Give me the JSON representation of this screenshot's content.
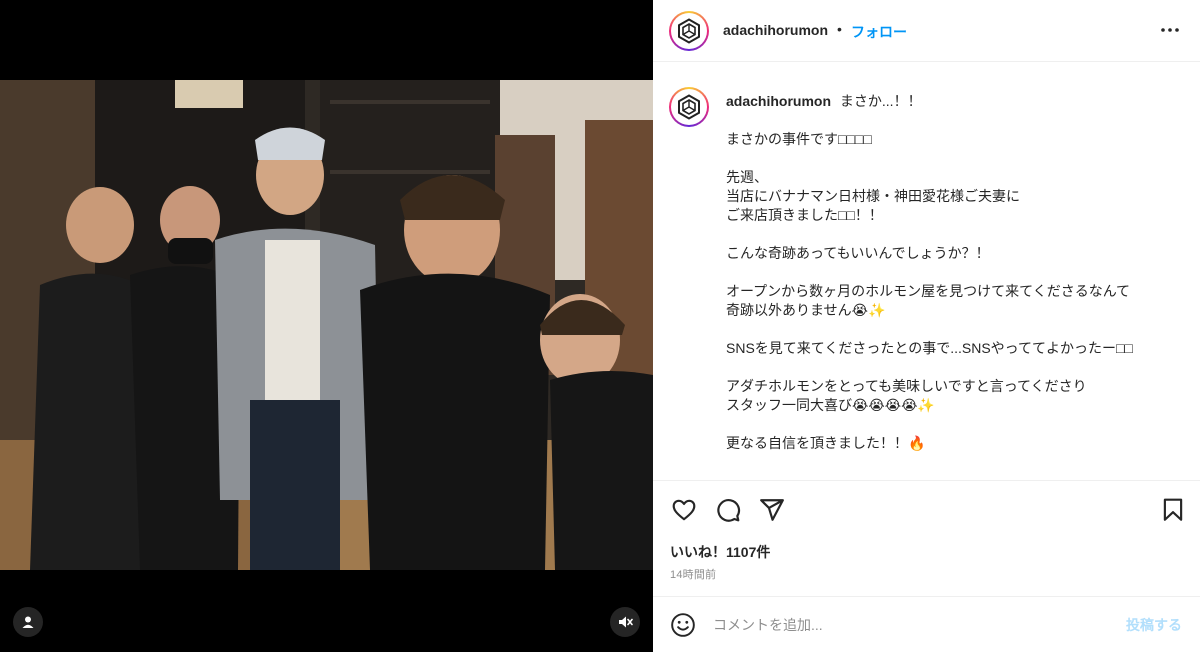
{
  "post": {
    "username": "adachihorumon",
    "follow_label": "フォロー",
    "dot": "•",
    "caption_first": "まさか...！！",
    "caption_lines": [
      "まさかの事件です□□□□",
      "",
      "先週、",
      "当店にバナナマン日村様・神田愛花様ご夫妻に",
      "ご来店頂きました□□！！",
      "",
      "こんな奇跡あってもいいんでしょうか？！",
      "",
      "オープンから数ヶ月のホルモン屋を見つけて来てくださるなんて",
      "奇跡以外ありません😭✨",
      "",
      "SNSを見て来てくださったとの事で...SNSやっててよかったー□□",
      "",
      "アダチホルモンをとっても美味しいですと言ってくださり",
      "スタッフ一同大喜び😭😭😭😭✨",
      "",
      "更なる自信を頂きました！！🔥"
    ],
    "likes": "いいね！1107件",
    "time": "14時間前",
    "comment_placeholder": "コメントを追加...",
    "post_button": "投稿する"
  },
  "icons": {
    "more": "more-horizontal-icon",
    "like": "heart-icon",
    "comment": "comment-icon",
    "share": "paper-plane-icon",
    "save": "bookmark-icon",
    "emoji": "emoji-icon",
    "tagged": "user-tag-icon",
    "mute": "speaker-muted-icon"
  },
  "colors": {
    "accent": "#0095f6",
    "post_disabled": "#b2dffc",
    "text": "#262626",
    "muted": "#8e8e8e",
    "media_bg": "#000000"
  }
}
